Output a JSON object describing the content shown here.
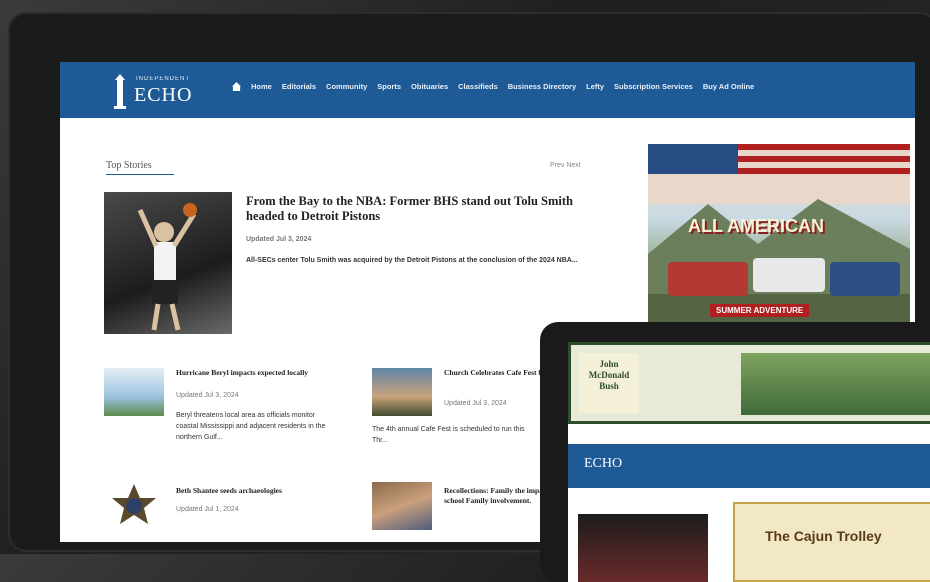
{
  "site": {
    "logo_small": "INDEPENDENT",
    "logo_big": "ECHO",
    "nav": [
      "Home",
      "Editorials",
      "Community",
      "Sports",
      "Obituaries",
      "Classifieds",
      "Business Directory",
      "Lefty",
      "Subscription Services",
      "Buy Ad Online"
    ]
  },
  "section": {
    "title": "Top Stories",
    "pager": "Prev  Next"
  },
  "feature": {
    "headline": "From the Bay to the NBA: Former BHS stand out Tolu Smith headed to Detroit Pistons",
    "meta": "Updated Jul 3, 2024",
    "excerpt": "All-SECs center Tolu Smith was acquired by the Detroit Pistons at the conclusion of the 2024 NBA..."
  },
  "stories": [
    {
      "title": "Hurricane Beryl impacts expected locally",
      "meta": "Updated Jul 3, 2024",
      "excerpt": "Beryl threatens local area as officials monitor coastal Mississippi and adjacent residents in the northern Gulf..."
    },
    {
      "title": "Church Celebrates Cafe Fest begins Three",
      "meta": "Updated Jul 3, 2024",
      "excerpt": "The 4th annual Cafe Fest is scheduled to run this Thr..."
    },
    {
      "title": "Beth Shantee seeds archaeologies",
      "meta": "Updated Jul 1, 2024",
      "excerpt": ""
    },
    {
      "title": "Recollections: Family the impact of school Family involvement.",
      "meta": "",
      "excerpt": ""
    }
  ],
  "ad": {
    "title": "ALL AMERICAN",
    "sub": "SUMMER ADVENTURE"
  },
  "tablet": {
    "ad_name": "John McDonald Bush",
    "logo_big": "ECHO",
    "ad2_title": "The Cajun Trolley"
  },
  "colors": {
    "brand_blue": "#1e5a96",
    "ad_red": "#b02020"
  }
}
